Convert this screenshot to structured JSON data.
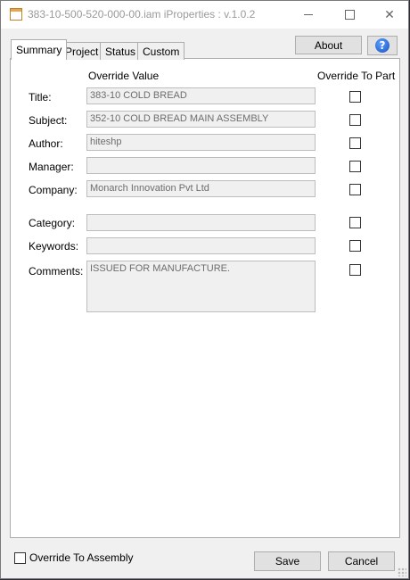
{
  "window": {
    "title": "383-10-500-520-000-00.iam iProperties : v.1.0.2",
    "min_glyph": "minimize",
    "max_glyph": "maximize",
    "close_glyph": "✕"
  },
  "tabs": [
    {
      "label": "Summary",
      "selected": true
    },
    {
      "label": "Project",
      "selected": false
    },
    {
      "label": "Status",
      "selected": false
    },
    {
      "label": "Custom",
      "selected": false
    }
  ],
  "toolbar": {
    "about_label": "About",
    "help_glyph": "?"
  },
  "headers": {
    "override_value": "Override Value",
    "override_to_part": "Override To Part"
  },
  "fields": [
    {
      "label": "Title:",
      "value": "383-10 COLD BREAD",
      "override_checked": false
    },
    {
      "label": "Subject:",
      "value": "352-10 COLD BREAD MAIN ASSEMBLY",
      "override_checked": false
    },
    {
      "label": "Author:",
      "value": "hiteshp",
      "override_checked": false
    },
    {
      "label": "Manager:",
      "value": "",
      "override_checked": false
    },
    {
      "label": "Company:",
      "value": "Monarch Innovation Pvt Ltd",
      "override_checked": false
    },
    {
      "label": "Category:",
      "value": "",
      "override_checked": false
    },
    {
      "label": "Keywords:",
      "value": "",
      "override_checked": false
    },
    {
      "label": "Comments:",
      "value": "ISSUED FOR MANUFACTURE.",
      "override_checked": false
    }
  ],
  "footer": {
    "override_assembly_label": "Override To Assembly",
    "override_assembly_checked": false,
    "save_label": "Save",
    "cancel_label": "Cancel"
  }
}
